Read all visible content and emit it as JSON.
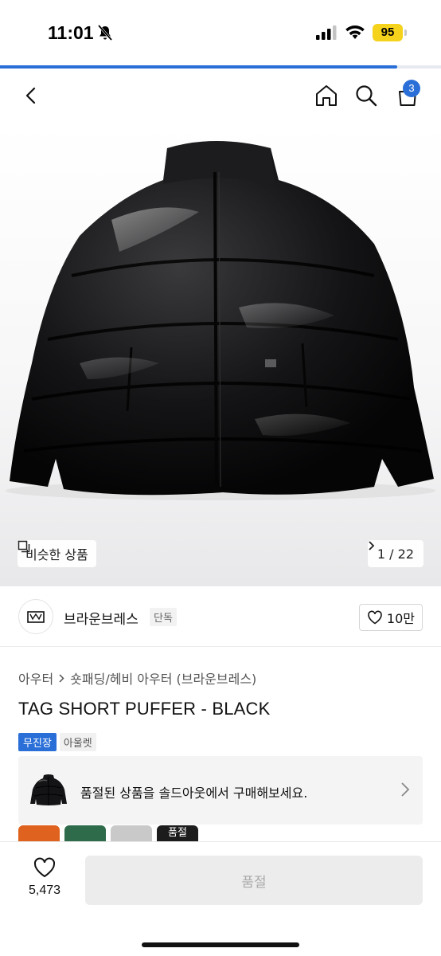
{
  "status_bar": {
    "time": "11:01",
    "battery": "95",
    "battery_color": "#f5d21b"
  },
  "page_progress": 0.9,
  "header": {
    "back_icon": "chevron-left-icon",
    "home_icon": "home-icon",
    "search_icon": "search-icon",
    "cart_icon": "shopping-bag-icon",
    "cart_count": "3",
    "accent": "#2a6fd8"
  },
  "gallery": {
    "similar_label": "비슷한 상품",
    "counter": "1 / 22"
  },
  "brand": {
    "name": "브라운브레스",
    "tag": "단독",
    "like_count": "10만"
  },
  "product": {
    "breadcrumb": [
      "아우터",
      "숏패딩/헤비 아우터 (브라운브레스)"
    ],
    "title": "TAG SHORT PUFFER - BLACK",
    "badges": {
      "primary": "무진장",
      "secondary": "아울렛"
    }
  },
  "soldout_banner": {
    "text": "품절된 상품을 솔드아웃에서 구매해보세요."
  },
  "color_options": {
    "colors": [
      "#e0621f",
      "#2e6b4b",
      "#c9c9c9",
      "#1c1c1c"
    ],
    "soldout_label": "품절"
  },
  "bottom_bar": {
    "wish_count": "5,473",
    "buy_label": "품절"
  }
}
